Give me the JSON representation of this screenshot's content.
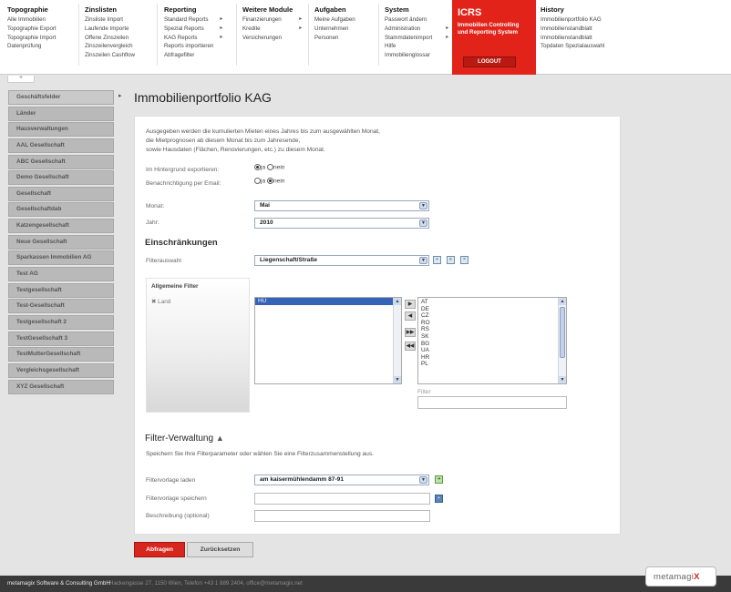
{
  "menu": {
    "topographie": {
      "head": "Topographie",
      "items": [
        "Alle Immobilien",
        "Topographie Export",
        "Topographie Import",
        "Datenprüfung"
      ]
    },
    "zinslisten": {
      "head": "Zinslisten",
      "items": [
        "Zinsliste Import",
        "Laufende Importe",
        "Offene Zinszeilen",
        "Zinszeilenvergleich",
        "Zinszeilen Cashflow"
      ]
    },
    "reporting": {
      "head": "Reporting",
      "items": [
        "Standard Reports",
        "Spezial Reports",
        "KAG Reports",
        "Reports importieren",
        "Abfragefilter"
      ]
    },
    "weitere": {
      "head": "Weitere Module",
      "items": [
        "Finanzierungen",
        "Kredite",
        "Versicherungen"
      ]
    },
    "aufgaben": {
      "head": "Aufgaben",
      "items": [
        "Meine Aufgaben",
        "Unternehmen",
        "Personen"
      ]
    },
    "system": {
      "head": "System",
      "items": [
        "Passwort ändern",
        "Administration",
        "Stammdatenimport",
        "Hilfe",
        "Immobilienglossar"
      ]
    },
    "history": {
      "head": "History",
      "items": [
        "Immobilienportfolio KAG",
        "Immobilienstandblatt",
        "Immobilienstandblatt",
        "Topdaten Spezialauswahl"
      ]
    }
  },
  "icrs": {
    "title": "ICRS",
    "subtitle_1": "Immobilien Controlling",
    "subtitle_2": "und Reporting System",
    "logout": "LOGOUT"
  },
  "sidebar": {
    "items": [
      "Geschäftsfelder",
      "Länder",
      "Hausverwaltungen",
      "AAL Gesellschaft",
      "ABC Gesellschaft",
      "Demo Gesellschaft",
      "Gesellschaft",
      "Gesellschaftdab",
      "Katzengesellschaft",
      "Neue Gesellschaft",
      "Sparkassen Immobilien AG",
      "Test AG",
      "Testgesellschaft",
      "Test-Gesellschaft",
      "Testgesellschaft 2",
      "TestGesellschaft 3",
      "TestMutterGesellschaft",
      "Vergleichsgesellschaft",
      "XYZ Gesellschaft"
    ]
  },
  "main": {
    "title": "Immobilienportfolio KAG",
    "intro_1": "Ausgegeben werden die kumulierten Mieten eines Jahres bis zum ausgewählten Monat,",
    "intro_2": "die Mietprognosen ab diesem Monat bis zum Jahresende,",
    "intro_3": "sowie Hausdaten (Flächen, Renovierungen, etc.) zu diesem Monat.",
    "bg_export_label": "Im Hintergrund exportieren:",
    "email_label": "Benachrichtigung per Email:",
    "ja": "ja",
    "nein": "nein",
    "month_label": "Monat:",
    "month_value": "Mai",
    "year_label": "Jahr:",
    "year_value": "2010",
    "restrictions_heading": "Einschränkungen",
    "filter_choice_label": "Filterauswahl",
    "filter_choice_value": "Liegenschaft/Straße",
    "general_filter": "Allgemeine Filter",
    "land_label": "Land",
    "selected_list": [
      "HU"
    ],
    "available_list": [
      "AT",
      "DE",
      "CZ",
      "RO",
      "RS",
      "SK",
      "BG",
      "UA",
      "HR",
      "PL"
    ],
    "filter_label": "Filter",
    "filter_mgmt_heading": "Filter-Verwaltung",
    "filter_mgmt_text": "Speichern Sie Ihre Filterparameter oder wählen Sie eine Filterzusammenstellung aus.",
    "load_label": "Filtervorlage laden",
    "load_value": "am kaisermühlendamm 87-91",
    "save_label": "Filtervorlage speichern",
    "desc_label": "Beschreibung (optional)",
    "btn_submit": "Abfragen",
    "btn_reset": "Zurücksetzen"
  },
  "footer": {
    "company": "metamagix Software & Consulting GmbH",
    "address": "Hackengasse 27, 1150 Wien, Telefon +43 1 889 2404, office@metamagix.net",
    "logo": "metamagi",
    "logo_x": "X"
  }
}
